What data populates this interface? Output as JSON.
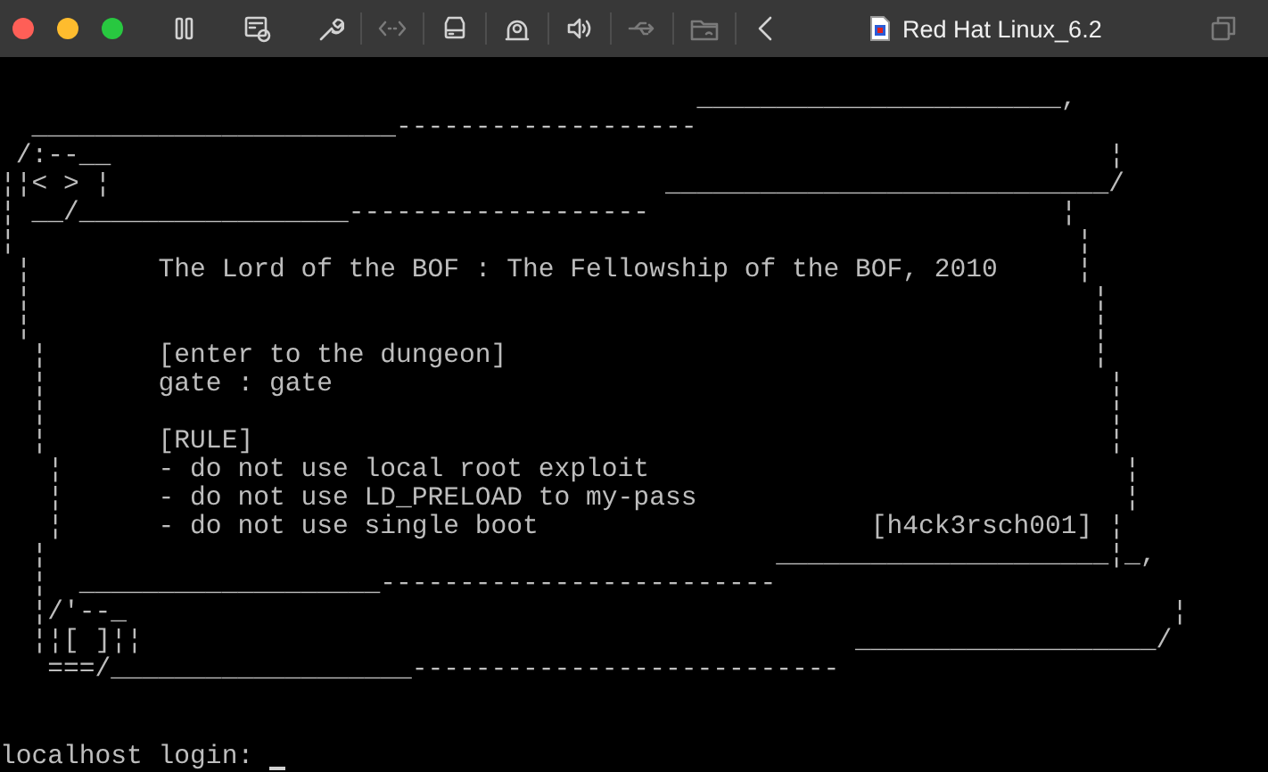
{
  "window": {
    "title": "Red Hat Linux_6.2"
  },
  "toolbar": {
    "left": [
      {
        "kind": "pause",
        "disabled": false
      },
      {
        "kind": "configure",
        "disabled": false
      }
    ],
    "devices": [
      {
        "kind": "wrench",
        "disabled": false
      },
      {
        "kind": "network",
        "disabled": true
      },
      {
        "kind": "drive",
        "disabled": false
      },
      {
        "kind": "camera",
        "disabled": false
      },
      {
        "kind": "sound",
        "disabled": false
      },
      {
        "kind": "usb",
        "disabled": true
      },
      {
        "kind": "folder",
        "disabled": true
      },
      {
        "kind": "back",
        "disabled": false
      }
    ],
    "right": [
      {
        "kind": "coherence",
        "disabled": true
      }
    ]
  },
  "console": {
    "lines": [
      "                                            _______________________,",
      "  _______________________-------------------",
      " /:--__                                                               ¦",
      "¦¦< > ¦                                   ____________________________/",
      "¦ __/_________________-------------------                          ¦",
      "¦                                                                   ¦",
      " ¦        The Lord of the BOF : The Fellowship of the BOF, 2010     ¦",
      " ¦                                                                   ¦",
      " ¦                                                                   ¦",
      "  ¦       [enter to the dungeon]                                     ¦",
      "  ¦       gate : gate                                                 ¦",
      "  ¦                                                                   ¦",
      "  ¦       [RULE]                                                      ¦",
      "   ¦      - do not use local root exploit                              ¦",
      "   ¦      - do not use LD_PRELOAD to my-pass                           ¦",
      "   ¦      - do not use single boot                     [h4ck3rsch001] ¦",
      "  ¦                                              _____________________¦_,",
      "  ¦  ___________________-------------------------",
      "  ¦/'--_                                                                  ¦",
      "  ¦¦[ ]¦¦                                             ___________________/",
      "   ===/___________________---------------------------"
    ],
    "prompt": "localhost login:"
  }
}
